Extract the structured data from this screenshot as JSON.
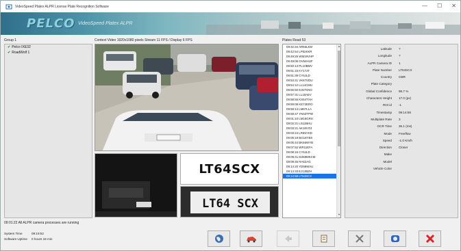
{
  "window": {
    "title": "VideoSpeed Platex ALPR License Plate Recognition Software",
    "controls": [
      "—",
      "☐",
      "✕"
    ]
  },
  "banner": {
    "logo": "PELCO",
    "subtitle": "VideoSpeed Platex ALPR"
  },
  "group": {
    "label": "Group 1",
    "items": [
      {
        "label": "Pelco IXE32"
      },
      {
        "label": "RoadWolf 1"
      }
    ]
  },
  "video": {
    "context_label": "Context Video 1920x1080 pixels Stream 11 FPS / Display 6 FPS"
  },
  "plate": {
    "recognized_text": "LT64SCX",
    "image_text": "LT64 SCX"
  },
  "plates_read": {
    "label": "Plates Read 53",
    "rows": [
      "09:32:34 AR66LKM",
      "09:42:54 LP62KKR",
      "09:49:25 WM19VHP",
      "09:49:06 OV64HUF",
      "09:50:13 PL10BMV",
      "09:51:15 KY17JT",
      "09:51:39 CY5JLD",
      "09:53:41 VK67UDU",
      "09:54:12 LL14CMU",
      "09:56:50 EJ67KNO",
      "09:57:31 LL18AEV",
      "09:58:55 KS54TXH",
      "09:59:08 KE72ERO",
      "09:59:14 LM67LLA",
      "09:59:47 YN63TPW",
      "09:01:10 LM16GRX",
      "09:02:21 LS11BHU",
      "09:03:21 AK18VOJ",
      "09:03:24 LR65YKD",
      "09:05:18 BG18YBS",
      "09:05:44 BK66WYB",
      "09:07:52 WR11EFA",
      "09:08:16 CY5JLD",
      "09:09:41 MJ68MKCM",
      "09:09:45 RA62AG",
      "09:14:20 YD68WAU",
      "09:14:33 EJ13BZH",
      "09:14:58 LT64SCX"
    ],
    "selected_index": 27
  },
  "details": [
    {
      "k": "Latitude",
      "v": "?"
    },
    {
      "k": "Longitude",
      "v": "?"
    },
    {
      "k": "ALPR Camera ID",
      "v": "1"
    },
    {
      "k": "Plate Number",
      "v": "LT64SCX"
    },
    {
      "k": "Country",
      "v": "GBR"
    },
    {
      "k": "Plate Category",
      "v": ""
    },
    {
      "k": "Global Confidence",
      "v": "98.7 %"
    },
    {
      "k": "Characters Height",
      "v": "17.0 (px)"
    },
    {
      "k": "ROI id",
      "v": "-1"
    },
    {
      "k": "Timestamp",
      "v": "09:14:58"
    },
    {
      "k": "Multiplate Rate",
      "v": "3"
    },
    {
      "k": "OCR Time",
      "v": "36.1 (ms)"
    },
    {
      "k": "Mode",
      "v": "Freeflow"
    },
    {
      "k": "Speed",
      "v": "-1.0 Km/h"
    },
    {
      "k": "Direction",
      "v": "Closer"
    },
    {
      "k": "Make",
      "v": ""
    },
    {
      "k": "Model",
      "v": ""
    },
    {
      "k": "Vehicle Color",
      "v": ""
    }
  ],
  "status": {
    "message": "09:01:22 All ALPR camera processes are running",
    "system_time_label": "System Time",
    "system_time": "09:19:52",
    "uptime_label": "Software Uptime",
    "uptime": "0 hours 18 min"
  },
  "toolbar": {
    "buttons": [
      {
        "name": "globe-icon",
        "color": "#3c6fb0"
      },
      {
        "name": "vehicle-icon",
        "color": "#e0402f"
      },
      {
        "name": "arrow-icon",
        "color": "#c9c9c9"
      },
      {
        "name": "list-icon",
        "color": "#8a6d3b"
      },
      {
        "name": "tools-icon",
        "color": "#777777"
      },
      {
        "name": "power-icon",
        "color": "#2f63c6"
      },
      {
        "name": "close-icon",
        "color": "#d8232a"
      }
    ]
  }
}
